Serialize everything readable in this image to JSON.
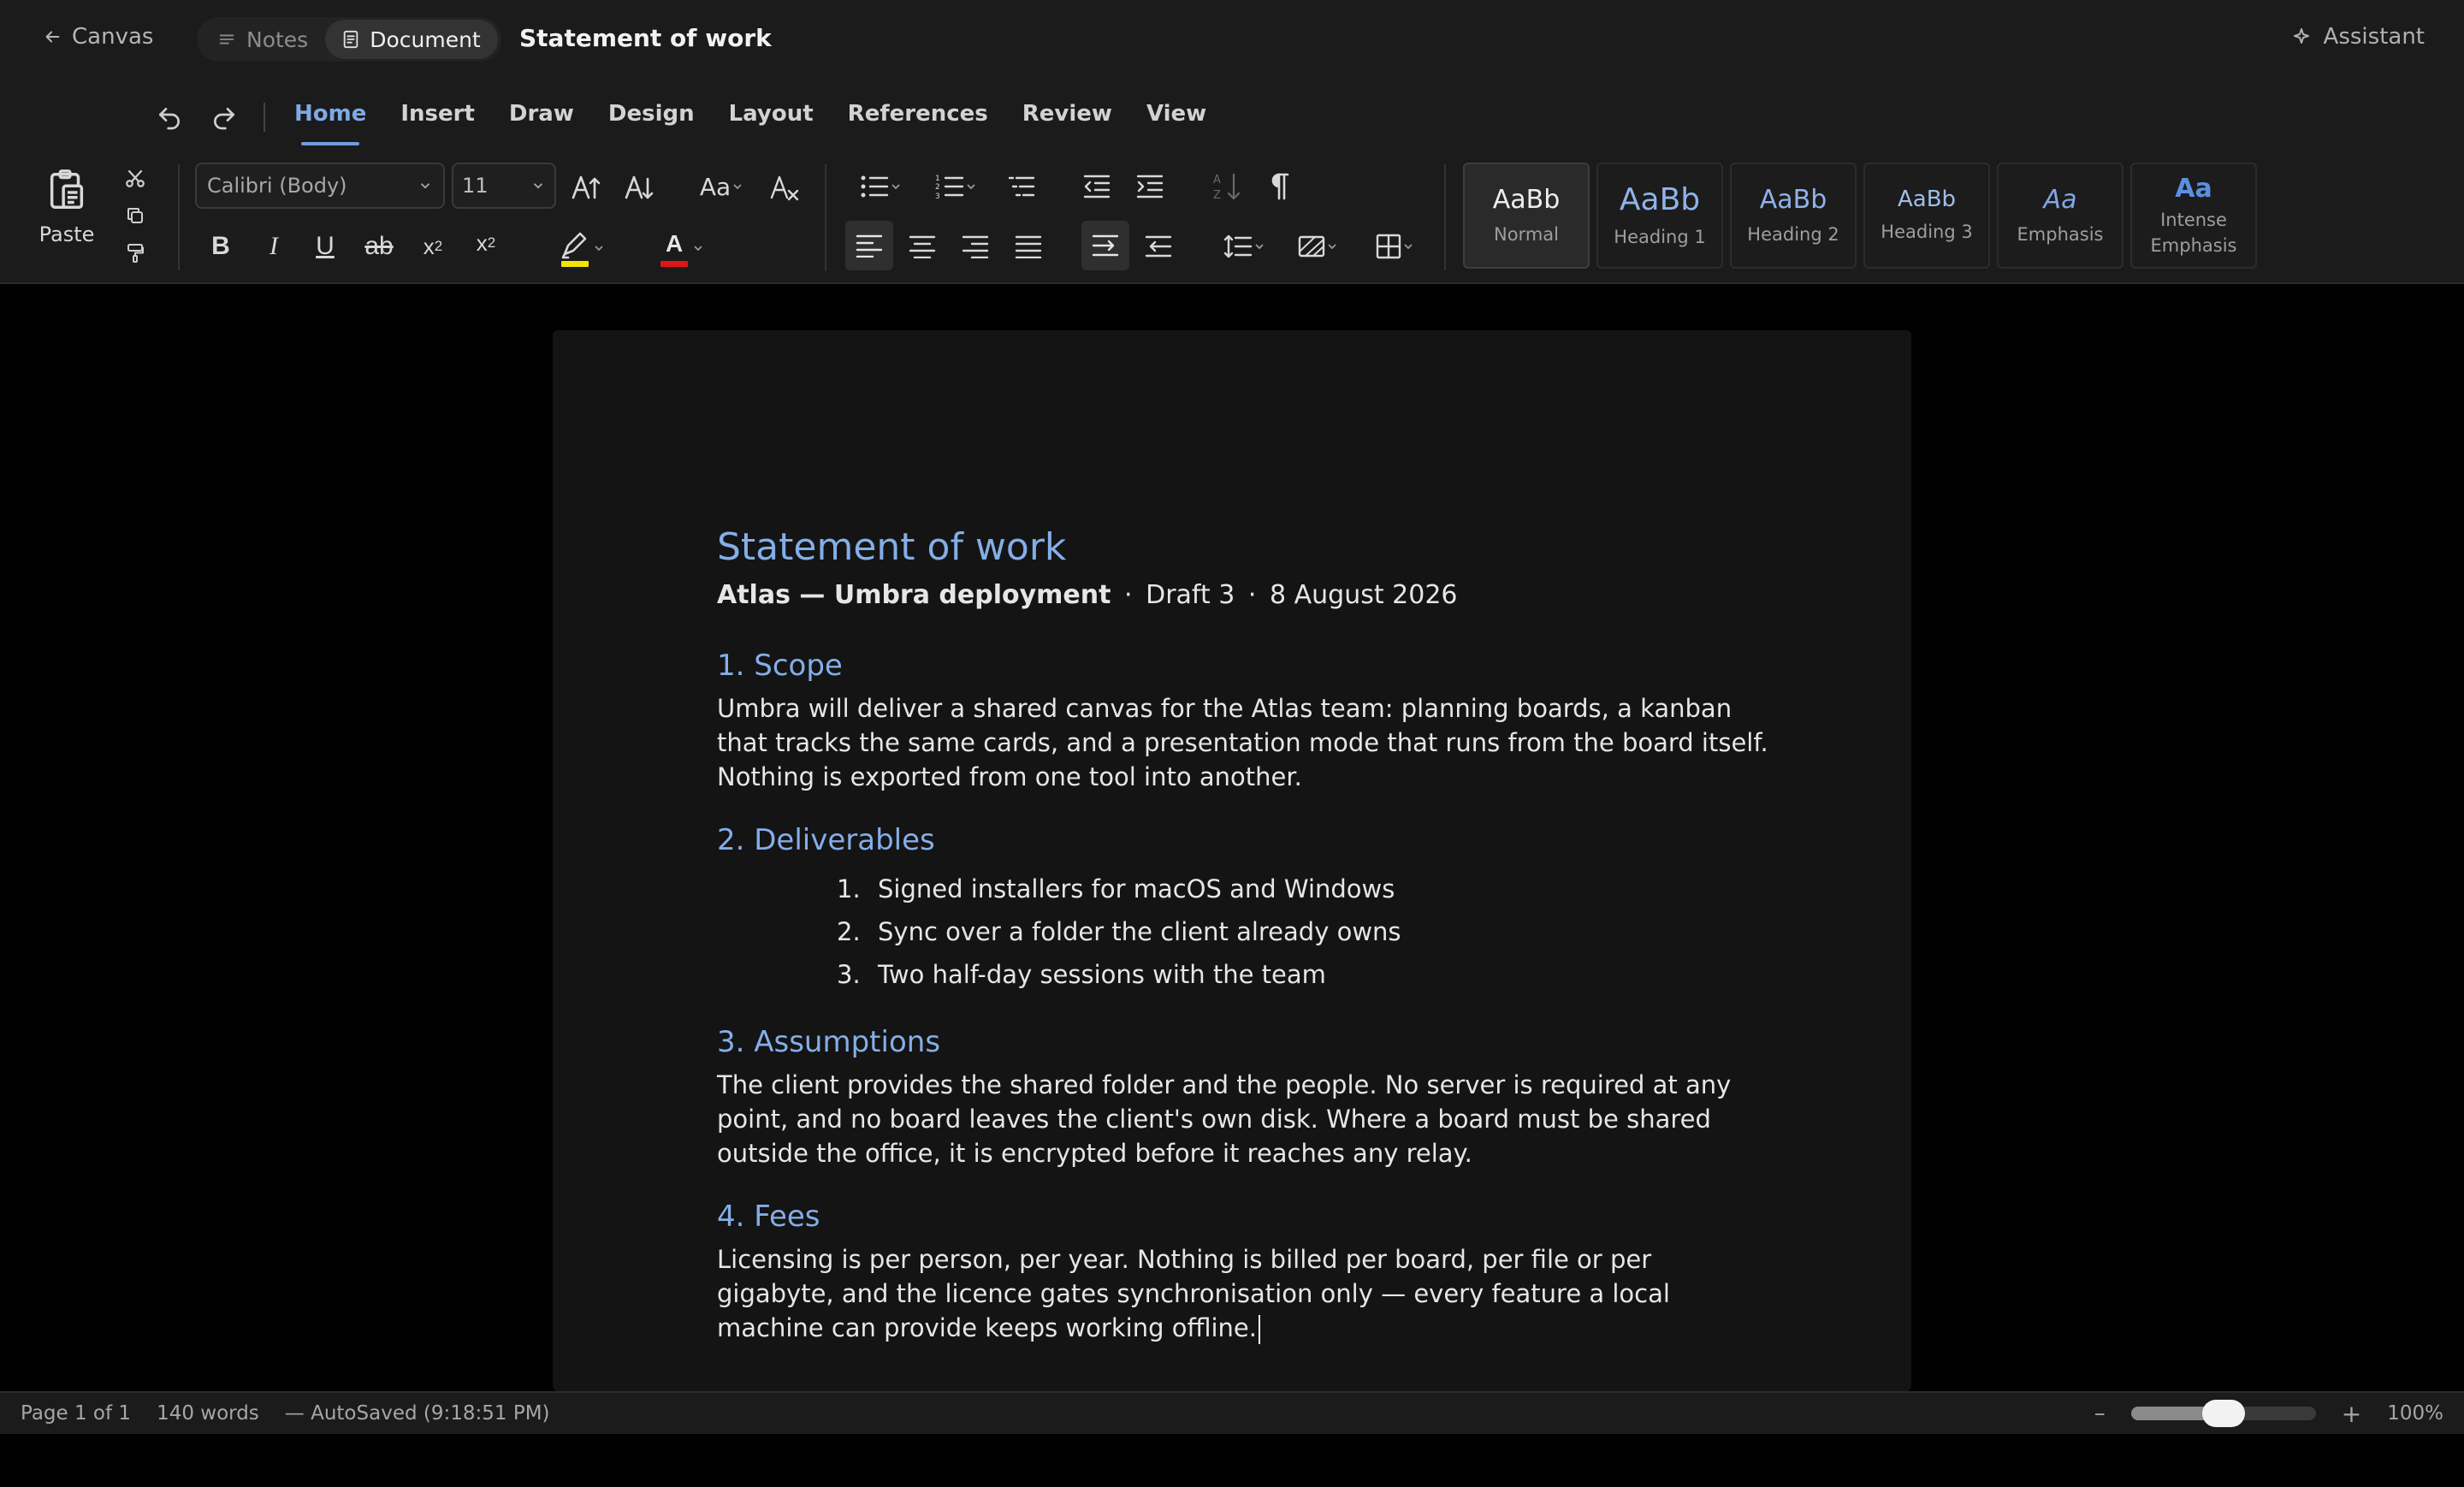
{
  "topbar": {
    "back_label": "Canvas",
    "view_tabs": [
      {
        "label": "Notes",
        "active": false
      },
      {
        "label": "Document",
        "active": true
      }
    ],
    "title": "Statement of work",
    "assistant_label": "Assistant"
  },
  "menu": {
    "tabs": [
      {
        "label": "Home",
        "active": true
      },
      {
        "label": "Insert"
      },
      {
        "label": "Draw"
      },
      {
        "label": "Design"
      },
      {
        "label": "Layout"
      },
      {
        "label": "References"
      },
      {
        "label": "Review"
      },
      {
        "label": "View"
      }
    ]
  },
  "ribbon": {
    "paste_label": "Paste",
    "font_name": "Calibri (Body)",
    "font_size": "11",
    "change_case_label": "Aa",
    "format_labels": {
      "bold": "B",
      "italic": "I",
      "underline": "U",
      "strike": "ab",
      "sub_base": "x",
      "sub_idx": "2",
      "sup_base": "x",
      "sup_idx": "2",
      "font_color": "A"
    },
    "highlight_color": "#f2e600",
    "font_color": "#e01515",
    "styles": [
      {
        "sample": "AaBb",
        "name": "Normal",
        "active": true
      },
      {
        "sample": "AaBb",
        "name": "Heading 1"
      },
      {
        "sample": "AaBb",
        "name": "Heading 2"
      },
      {
        "sample": "AaBb",
        "name": "Heading 3"
      },
      {
        "sample": "Aa",
        "name": "Emphasis"
      },
      {
        "sample": "Aa",
        "name": "Intense Emphasis"
      }
    ]
  },
  "document": {
    "title": "Statement of work",
    "subtitle_strong": "Atlas — Umbra deployment",
    "subtitle_sep1": "·",
    "subtitle_draft": "Draft 3",
    "subtitle_sep2": "·",
    "subtitle_date": "8 August 2026",
    "sections": [
      {
        "heading": "1. Scope",
        "body": "Umbra will deliver a shared canvas for the Atlas team: planning boards, a kanban that tracks the same cards, and a presentation mode that runs from the board itself. Nothing is exported from one tool into another."
      },
      {
        "heading": "2. Deliverables",
        "items": [
          {
            "num": "1.",
            "text": "Signed installers for macOS and Windows"
          },
          {
            "num": "2.",
            "text": "Sync over a folder the client already owns"
          },
          {
            "num": "3.",
            "text": "Two half-day sessions with the team"
          }
        ]
      },
      {
        "heading": "3. Assumptions",
        "body": "The client provides the shared folder and the people. No server is required at any point, and no board leaves the client's own disk. Where a board must be shared outside the office, it is encrypted before it reaches any relay."
      },
      {
        "heading": "4. Fees",
        "body": "Licensing is per person, per year. Nothing is billed per board, per file or per gigabyte, and the licence gates synchronisation only — every feature a local machine can provide keeps working offline."
      }
    ]
  },
  "status": {
    "page": "Page 1 of 1",
    "words": "140 words",
    "autosave": "— AutoSaved (9:18:51 PM)",
    "zoom_minus": "–",
    "zoom_plus": "+",
    "zoom_label": "100%",
    "zoom_value": 0.5
  },
  "colors": {
    "accent": "#6f9de0",
    "heading": "#84aee8",
    "page_bg": "#141414"
  }
}
